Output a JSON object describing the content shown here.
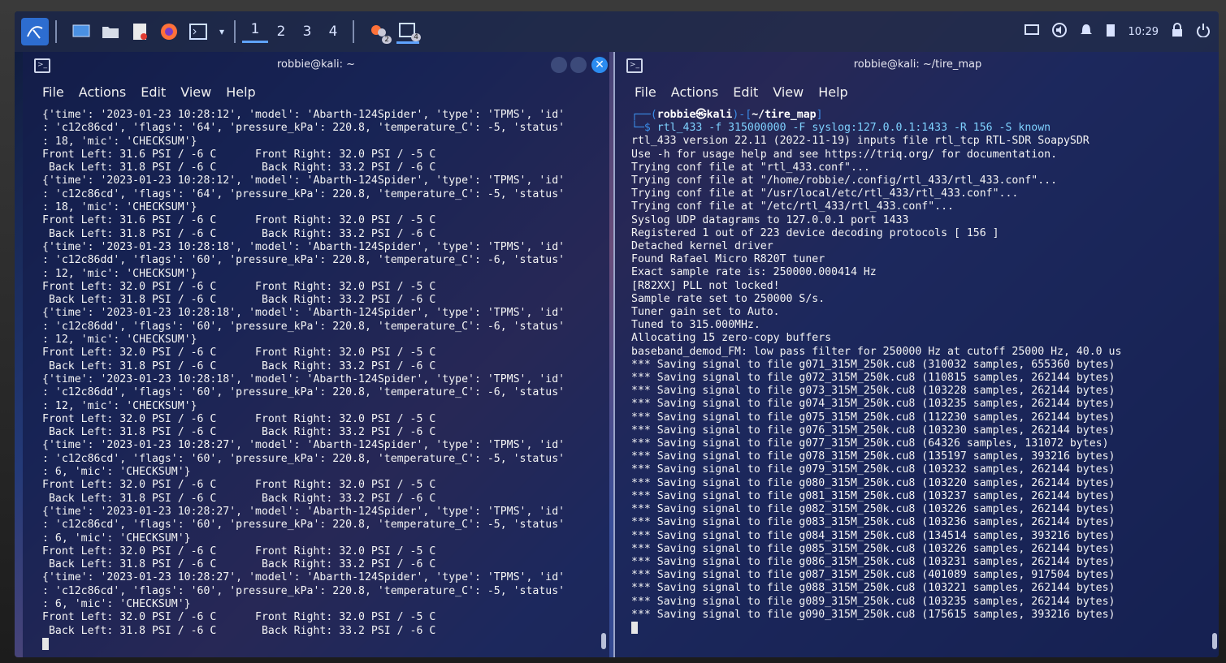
{
  "taskbar": {
    "workspaces": [
      "1",
      "2",
      "3",
      "4"
    ],
    "badges": [
      "2",
      "4"
    ],
    "clock": "10:29"
  },
  "left_terminal": {
    "title": "robbie@kali: ~",
    "menu": [
      "File",
      "Actions",
      "Edit",
      "View",
      "Help"
    ],
    "lines": [
      "{'time': '2023-01-23 10:28:12', 'model': 'Abarth-124Spider', 'type': 'TPMS', 'id'",
      ": 'c12c86cd', 'flags': '64', 'pressure_kPa': 220.8, 'temperature_C': -5, 'status'",
      ": 18, 'mic': 'CHECKSUM'}",
      "Front Left: 31.6 PSI / -6 C      Front Right: 32.0 PSI / -5 C",
      " Back Left: 31.8 PSI / -6 C       Back Right: 33.2 PSI / -6 C",
      "{'time': '2023-01-23 10:28:12', 'model': 'Abarth-124Spider', 'type': 'TPMS', 'id'",
      ": 'c12c86cd', 'flags': '64', 'pressure_kPa': 220.8, 'temperature_C': -5, 'status'",
      ": 18, 'mic': 'CHECKSUM'}",
      "Front Left: 31.6 PSI / -6 C      Front Right: 32.0 PSI / -5 C",
      " Back Left: 31.8 PSI / -6 C       Back Right: 33.2 PSI / -6 C",
      "{'time': '2023-01-23 10:28:18', 'model': 'Abarth-124Spider', 'type': 'TPMS', 'id'",
      ": 'c12c86dd', 'flags': '60', 'pressure_kPa': 220.8, 'temperature_C': -6, 'status'",
      ": 12, 'mic': 'CHECKSUM'}",
      "Front Left: 32.0 PSI / -6 C      Front Right: 32.0 PSI / -5 C",
      " Back Left: 31.8 PSI / -6 C       Back Right: 33.2 PSI / -6 C",
      "{'time': '2023-01-23 10:28:18', 'model': 'Abarth-124Spider', 'type': 'TPMS', 'id'",
      ": 'c12c86dd', 'flags': '60', 'pressure_kPa': 220.8, 'temperature_C': -6, 'status'",
      ": 12, 'mic': 'CHECKSUM'}",
      "Front Left: 32.0 PSI / -6 C      Front Right: 32.0 PSI / -5 C",
      " Back Left: 31.8 PSI / -6 C       Back Right: 33.2 PSI / -6 C",
      "{'time': '2023-01-23 10:28:18', 'model': 'Abarth-124Spider', 'type': 'TPMS', 'id'",
      ": 'c12c86dd', 'flags': '60', 'pressure_kPa': 220.8, 'temperature_C': -6, 'status'",
      ": 12, 'mic': 'CHECKSUM'}",
      "Front Left: 32.0 PSI / -6 C      Front Right: 32.0 PSI / -5 C",
      " Back Left: 31.8 PSI / -6 C       Back Right: 33.2 PSI / -6 C",
      "{'time': '2023-01-23 10:28:27', 'model': 'Abarth-124Spider', 'type': 'TPMS', 'id'",
      ": 'c12c86cd', 'flags': '60', 'pressure_kPa': 220.8, 'temperature_C': -5, 'status'",
      ": 6, 'mic': 'CHECKSUM'}",
      "Front Left: 32.0 PSI / -6 C      Front Right: 32.0 PSI / -5 C",
      " Back Left: 31.8 PSI / -6 C       Back Right: 33.2 PSI / -6 C",
      "{'time': '2023-01-23 10:28:27', 'model': 'Abarth-124Spider', 'type': 'TPMS', 'id'",
      ": 'c12c86cd', 'flags': '60', 'pressure_kPa': 220.8, 'temperature_C': -5, 'status'",
      ": 6, 'mic': 'CHECKSUM'}",
      "Front Left: 32.0 PSI / -6 C      Front Right: 32.0 PSI / -5 C",
      " Back Left: 31.8 PSI / -6 C       Back Right: 33.2 PSI / -6 C",
      "{'time': '2023-01-23 10:28:27', 'model': 'Abarth-124Spider', 'type': 'TPMS', 'id'",
      ": 'c12c86cd', 'flags': '60', 'pressure_kPa': 220.8, 'temperature_C': -5, 'status'",
      ": 6, 'mic': 'CHECKSUM'}",
      "Front Left: 32.0 PSI / -6 C      Front Right: 32.0 PSI / -5 C",
      " Back Left: 31.8 PSI / -6 C       Back Right: 33.2 PSI / -6 C"
    ]
  },
  "right_terminal": {
    "title": "robbie@kali: ~/tire_map",
    "menu": [
      "File",
      "Actions",
      "Edit",
      "View",
      "Help"
    ],
    "prompt_user": "robbie㉿kali",
    "prompt_dir": "~/tire_map",
    "command": "rtl_433 -f 315000000 -F syslog:127.0.0.1:1433 -R 156 -S known",
    "lines": [
      "rtl_433 version 22.11 (2022-11-19) inputs file rtl_tcp RTL-SDR SoapySDR",
      "Use -h for usage help and see https://triq.org/ for documentation.",
      "Trying conf file at \"rtl_433.conf\"...",
      "Trying conf file at \"/home/robbie/.config/rtl_433/rtl_433.conf\"...",
      "Trying conf file at \"/usr/local/etc/rtl_433/rtl_433.conf\"...",
      "Trying conf file at \"/etc/rtl_433/rtl_433.conf\"...",
      "Syslog UDP datagrams to 127.0.0.1 port 1433",
      "Registered 1 out of 223 device decoding protocols [ 156 ]",
      "Detached kernel driver",
      "Found Rafael Micro R820T tuner",
      "Exact sample rate is: 250000.000414 Hz",
      "[R82XX] PLL not locked!",
      "Sample rate set to 250000 S/s.",
      "Tuner gain set to Auto.",
      "Tuned to 315.000MHz.",
      "Allocating 15 zero-copy buffers",
      "baseband_demod_FM: low pass filter for 250000 Hz at cutoff 25000 Hz, 40.0 us",
      "*** Saving signal to file g071_315M_250k.cu8 (310032 samples, 655360 bytes)",
      "*** Saving signal to file g072_315M_250k.cu8 (110815 samples, 262144 bytes)",
      "*** Saving signal to file g073_315M_250k.cu8 (103228 samples, 262144 bytes)",
      "*** Saving signal to file g074_315M_250k.cu8 (103235 samples, 262144 bytes)",
      "*** Saving signal to file g075_315M_250k.cu8 (112230 samples, 262144 bytes)",
      "*** Saving signal to file g076_315M_250k.cu8 (103230 samples, 262144 bytes)",
      "*** Saving signal to file g077_315M_250k.cu8 (64326 samples, 131072 bytes)",
      "*** Saving signal to file g078_315M_250k.cu8 (135197 samples, 393216 bytes)",
      "*** Saving signal to file g079_315M_250k.cu8 (103232 samples, 262144 bytes)",
      "*** Saving signal to file g080_315M_250k.cu8 (103220 samples, 262144 bytes)",
      "*** Saving signal to file g081_315M_250k.cu8 (103237 samples, 262144 bytes)",
      "*** Saving signal to file g082_315M_250k.cu8 (103226 samples, 262144 bytes)",
      "*** Saving signal to file g083_315M_250k.cu8 (103236 samples, 262144 bytes)",
      "*** Saving signal to file g084_315M_250k.cu8 (134514 samples, 393216 bytes)",
      "*** Saving signal to file g085_315M_250k.cu8 (103226 samples, 262144 bytes)",
      "*** Saving signal to file g086_315M_250k.cu8 (103231 samples, 262144 bytes)",
      "*** Saving signal to file g087_315M_250k.cu8 (401089 samples, 917504 bytes)",
      "*** Saving signal to file g088_315M_250k.cu8 (103221 samples, 262144 bytes)",
      "*** Saving signal to file g089_315M_250k.cu8 (103235 samples, 262144 bytes)",
      "*** Saving signal to file g090_315M_250k.cu8 (175615 samples, 393216 bytes)"
    ]
  },
  "colors": {
    "accent": "#2b8cf0",
    "terminal_bg": "#141e4b",
    "prompt": "#3b8eea"
  },
  "icons": [
    "kali-menu-icon",
    "desktop-icon",
    "files-icon",
    "text-editor-icon",
    "firefox-icon",
    "terminal-icon",
    "chevron-down-icon",
    "network-icon",
    "volume-icon",
    "bell-icon",
    "battery-icon",
    "lock-icon",
    "power-icon"
  ]
}
